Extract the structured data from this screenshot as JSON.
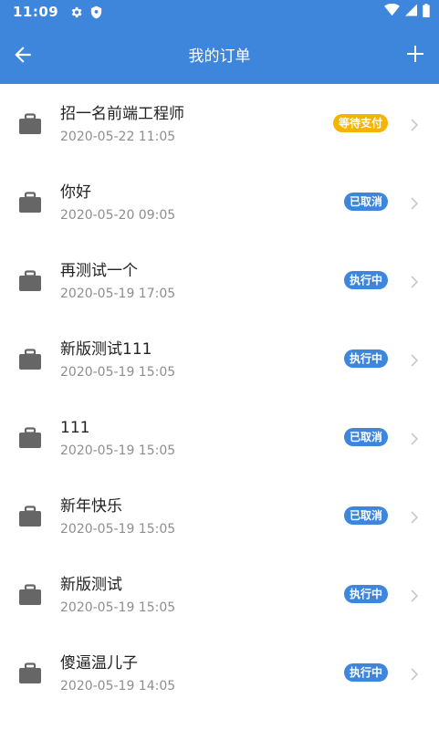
{
  "status_bar": {
    "time": "11:09"
  },
  "header": {
    "title": "我的订单"
  },
  "orders": [
    {
      "name": "招一名前端工程师",
      "date": "2020-05-22 11:05",
      "status": "等待支付",
      "status_type": "pending"
    },
    {
      "name": "你好",
      "date": "2020-05-20 09:05",
      "status": "已取消",
      "status_type": "cancel"
    },
    {
      "name": "再测试一个",
      "date": "2020-05-19 17:05",
      "status": "执行中",
      "status_type": "running"
    },
    {
      "name": "新版测试111",
      "date": "2020-05-19 15:05",
      "status": "执行中",
      "status_type": "running"
    },
    {
      "name": "111",
      "date": "2020-05-19 15:05",
      "status": "已取消",
      "status_type": "cancel"
    },
    {
      "name": "新年快乐",
      "date": "2020-05-19 15:05",
      "status": "已取消",
      "status_type": "cancel"
    },
    {
      "name": "新版测试",
      "date": "2020-05-19 15:05",
      "status": "执行中",
      "status_type": "running"
    },
    {
      "name": "傻逼温儿子",
      "date": "2020-05-19 14:05",
      "status": "执行中",
      "status_type": "running"
    }
  ],
  "colors": {
    "primary": "#3d86dc",
    "pending": "#f5b400"
  },
  "icons": {
    "back": "arrow-left-icon",
    "add": "plus-icon",
    "item": "briefcase-icon",
    "chevron": "chevron-right-icon"
  }
}
